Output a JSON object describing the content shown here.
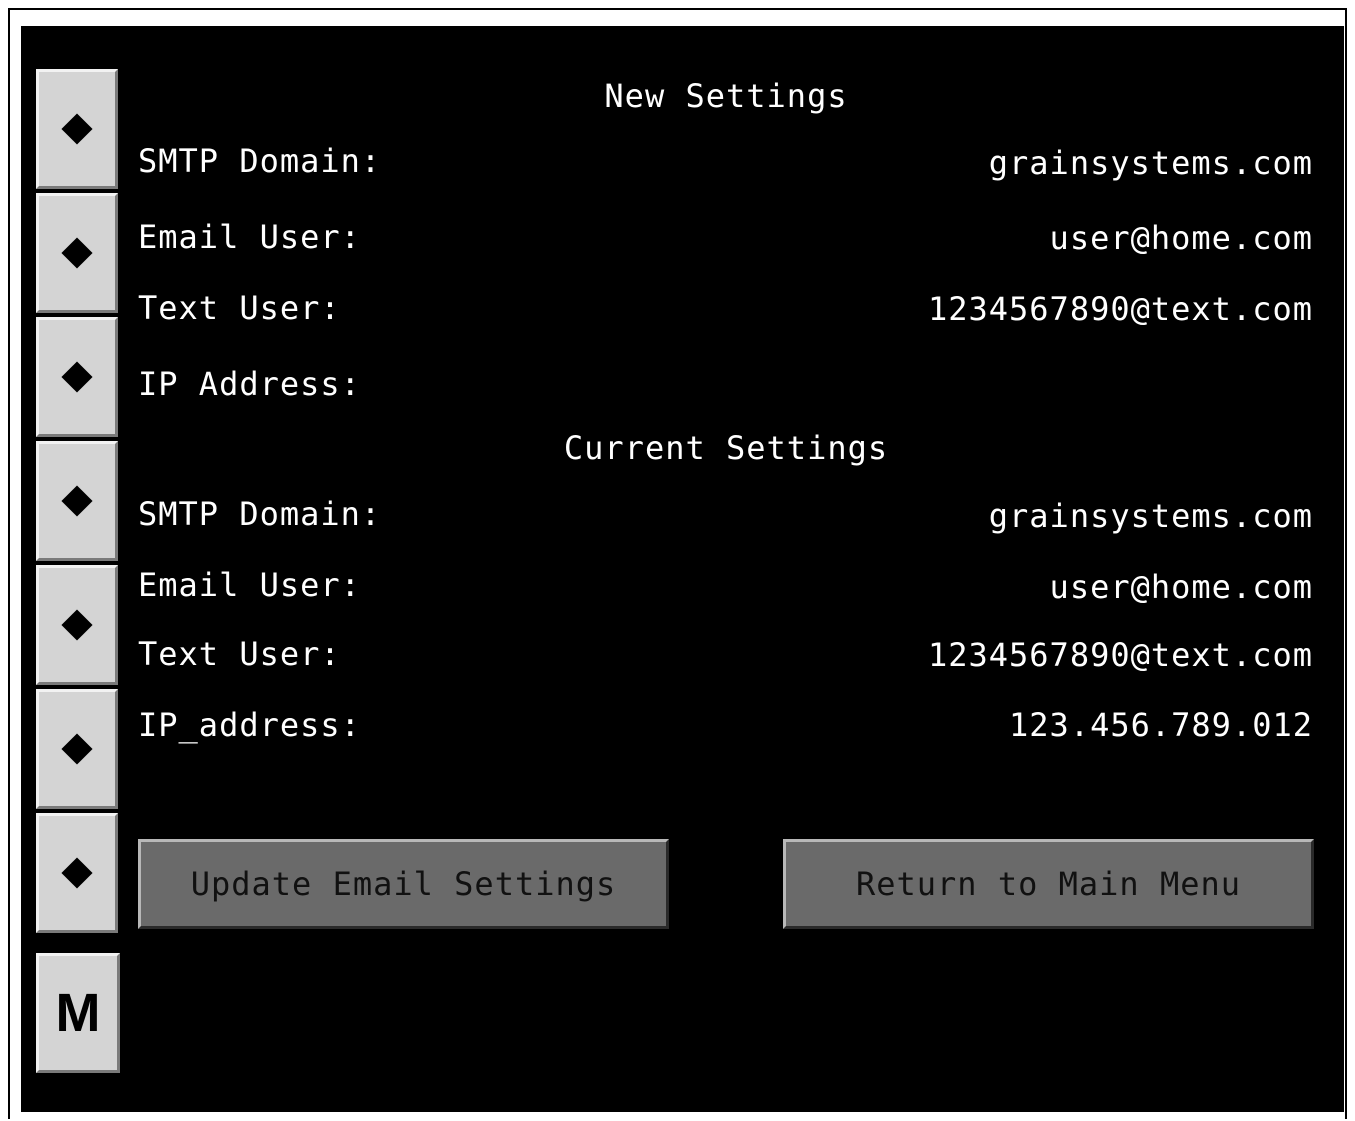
{
  "new_settings": {
    "heading": "New Settings",
    "smtp_domain_label": "SMTP Domain:",
    "smtp_domain_value": "grainsystems.com",
    "email_user_label": "Email User:",
    "email_user_value": "user@home.com",
    "text_user_label": "Text User:",
    "text_user_value": "1234567890@text.com",
    "ip_address_label": "IP Address:",
    "ip_address_value": ""
  },
  "current_settings": {
    "heading": "Current Settings",
    "smtp_domain_label": "SMTP Domain:",
    "smtp_domain_value": "grainsystems.com",
    "email_user_label": "Email User:",
    "email_user_value": "user@home.com",
    "text_user_label": "Text User:",
    "text_user_value": "1234567890@text.com",
    "ip_address_label": "IP_address:",
    "ip_address_value": "123.456.789.012"
  },
  "buttons": {
    "update_label": "Update Email Settings",
    "return_label": "Return to Main Menu",
    "menu_label": "M"
  },
  "side_buttons": [
    {
      "icon": "diamond-icon"
    },
    {
      "icon": "diamond-icon"
    },
    {
      "icon": "diamond-icon"
    },
    {
      "icon": "diamond-icon"
    },
    {
      "icon": "diamond-icon"
    },
    {
      "icon": "diamond-icon"
    },
    {
      "icon": "diamond-icon"
    }
  ],
  "colors": {
    "screen_background": "#000000",
    "text": "#ffffff",
    "side_button": "#d4d4d4",
    "action_button": "#6a6a6a"
  }
}
